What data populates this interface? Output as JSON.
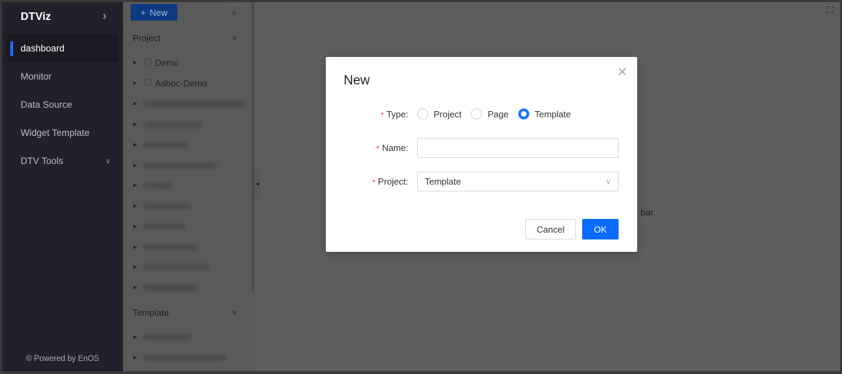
{
  "sidebar": {
    "brand": "DTViz",
    "items": [
      {
        "label": "dashboard",
        "active": true
      },
      {
        "label": "Monitor"
      },
      {
        "label": "Data Source"
      },
      {
        "label": "Widget Template"
      },
      {
        "label": "DTV Tools",
        "has_dropdown": true
      }
    ],
    "footer": "© Powered by EnOS"
  },
  "tree": {
    "new_label": "New",
    "project_section": "Project",
    "project_items": [
      "Demo",
      "Adhoc-Demo"
    ],
    "template_section": "Template"
  },
  "main": {
    "hint_fragment": "bar."
  },
  "modal": {
    "title": "New",
    "type_label": "Type",
    "type_options": [
      "Project",
      "Page",
      "Template"
    ],
    "type_selected": "Template",
    "name_label": "Name",
    "name_value": "",
    "project_label": "Project",
    "project_value": "Template",
    "cancel": "Cancel",
    "ok": "OK",
    "accent": "#0a6cff"
  }
}
